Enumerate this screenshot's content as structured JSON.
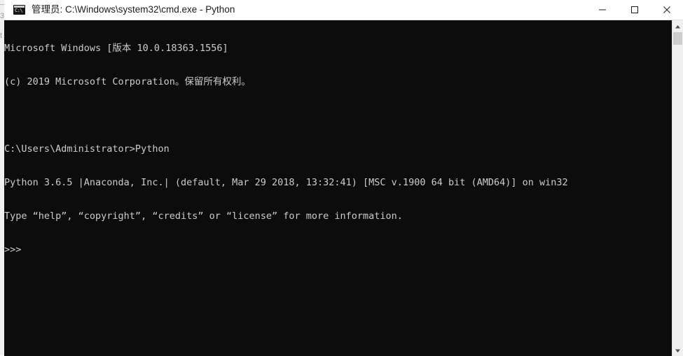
{
  "window": {
    "title": "管理员: C:\\Windows\\system32\\cmd.exe - Python",
    "icon": "cmd-console-icon",
    "icon_prompt_text": "C:\\",
    "titlebar_bg": "#ffffff",
    "titlebar_text_color": "#1b1b1b",
    "controls": {
      "minimize_label": "—",
      "minimize_name": "minimize-icon",
      "maximize_label": "□",
      "maximize_name": "maximize-icon",
      "close_label": "✕",
      "close_name": "close-icon"
    }
  },
  "console": {
    "background": "#0c0c0c",
    "foreground": "#cccccc",
    "font_size_px": 13.5,
    "line_height_px": 16,
    "lines": [
      "Microsoft Windows [版本 10.0.18363.1556]",
      "(c) 2019 Microsoft Corporation。保留所有权利。",
      "",
      "C:\\Users\\Administrator>Python",
      "Python 3.6.5 |Anaconda, Inc.| (default, Mar 29 2018, 13:32:41) [MSC v.1900 64 bit (AMD64)] on win32",
      "Type “help”, “copyright”, “credits” or “license” for more information.",
      ">>>"
    ],
    "prompt": ">>>",
    "shell_prompt": "C:\\Users\\Administrator>",
    "command_entered": "Python",
    "python_version": "3.6.5",
    "distribution": "Anaconda, Inc.",
    "build_date": "Mar 29 2018, 13:32:41",
    "compiler": "MSC v.1900 64 bit (AMD64)",
    "platform": "win32",
    "windows_version": "10.0.18363.1556",
    "copyright_year": "2019"
  },
  "scrollbar": {
    "up_arrow": "scroll-up-icon",
    "down_arrow": "scroll-down-icon",
    "thumb": "scroll-thumb",
    "track_color": "#f0f0f0",
    "thumb_color": "#cdcdcd"
  },
  "background_window_strip": {
    "glyphs": [
      "3",
      "t"
    ]
  }
}
